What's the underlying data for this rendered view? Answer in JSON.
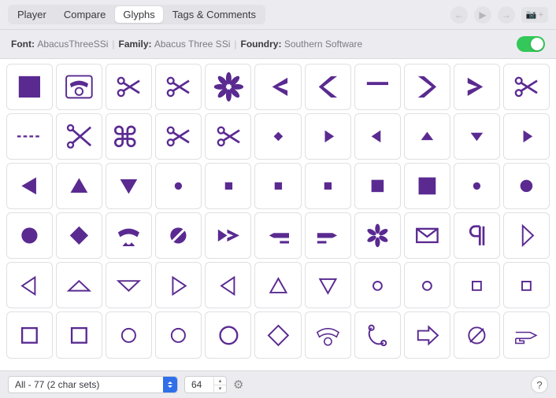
{
  "tabs": {
    "items": [
      "Player",
      "Compare",
      "Glyphs",
      "Tags & Comments"
    ],
    "active_index": 2
  },
  "toolbar_right": {
    "back_icon": "←",
    "play_icon": "▶",
    "forward_icon": "→",
    "camera_icon": "📷",
    "plus_icon": "+"
  },
  "info": {
    "font_label": "Font:",
    "font_value": "AbacusThreeSSi",
    "family_label": "Family:",
    "family_value": "Abacus Three SSi",
    "foundry_label": "Foundry:",
    "foundry_value": "Southern Software"
  },
  "glyph_color": "#5a2a91",
  "glyphs": [
    "filled-square",
    "telephone-framed",
    "scissors",
    "scissors",
    "flower-8",
    "arrow-left-big",
    "chevron-left-block",
    "minus-tall",
    "chevron-right-block",
    "arrow-right-big",
    "scissors",
    "dashed-line",
    "scissors-open",
    "command",
    "scissors",
    "scissors",
    "diamond-small",
    "triangle-right-small",
    "triangle-left-small",
    "triangle-up-small",
    "triangle-down-small",
    "triangle-right-small",
    "triangle-left",
    "triangle-up",
    "triangle-down",
    "dot-medium",
    "square-small",
    "square-small",
    "square-small",
    "square-medium",
    "square-large",
    "dot-medium",
    "dot-large",
    "circle-large",
    "diamond-large",
    "telephone",
    "circle-slash",
    "arrow-double-right",
    "hand-point-left",
    "hand-point-right",
    "asterisk",
    "envelope",
    "pilcrow",
    "triangle-right-outline-tall",
    "triangle-left-outline",
    "triangle-up-outline-wide",
    "triangle-down-outline-wide",
    "triangle-right-outline",
    "triangle-left-outline",
    "triangle-up-outline",
    "triangle-down-outline",
    "circle-outline-small",
    "circle-outline-small",
    "square-outline-small",
    "square-outline-small",
    "square-outline",
    "square-outline",
    "circle-outline",
    "circle-outline",
    "circle-outline-large",
    "diamond-outline",
    "telephone-outline",
    "handset-swirl",
    "arrow-right-outline",
    "circle-slash-outline",
    "hand-point-right-outline"
  ],
  "footer": {
    "charset_dropdown": "All - 77 (2 char sets)",
    "size_value": "64"
  }
}
